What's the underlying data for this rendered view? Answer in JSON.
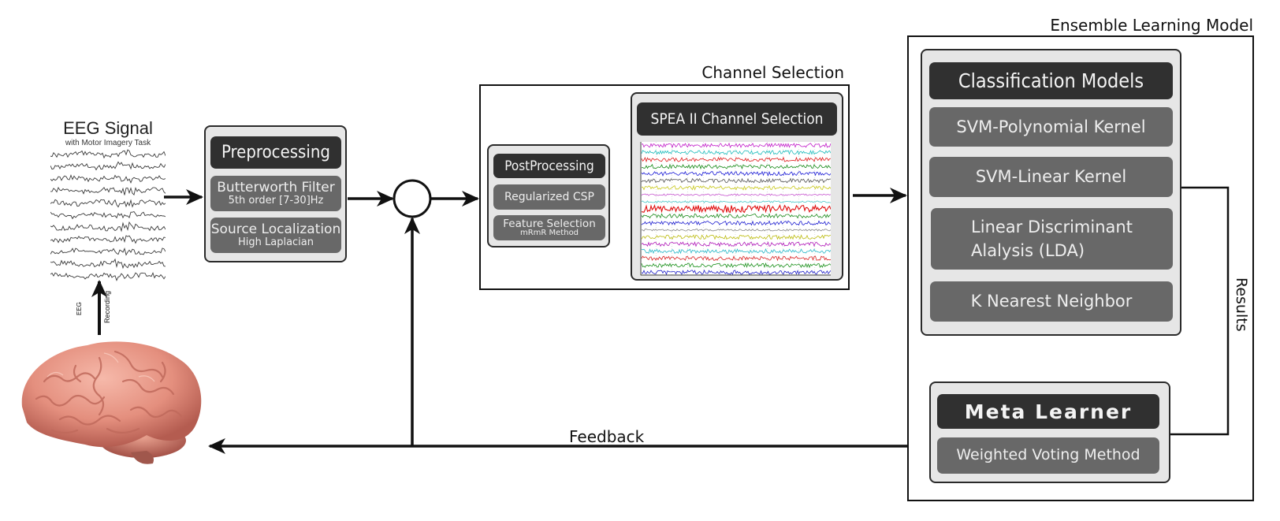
{
  "eeg_signal": {
    "title": "EEG Signal",
    "subtitle": "with Motor Imagery Task",
    "trace_count": 11
  },
  "recording": {
    "label_left": "EEG",
    "label_right": "Recording"
  },
  "brain": {
    "icon": "brain-icon"
  },
  "preprocessing": {
    "title": "Preprocessing",
    "items": [
      {
        "main": "Butterworth Filter",
        "sub": "5th order [7-30]Hz"
      },
      {
        "main": "Source Localization",
        "sub": "High Laplacian"
      }
    ]
  },
  "summing_junction": {
    "icon": "summing-junction-icon"
  },
  "channel_selection": {
    "frame_title": "Channel Selection",
    "postprocessing": {
      "title": "PostProcessing",
      "items": [
        {
          "main": "Regularized CSP",
          "sub": ""
        },
        {
          "main": "Feature Selection",
          "sub": "mRmR Method"
        }
      ]
    },
    "spea": {
      "title": "SPEA II Channel Selection",
      "trace_colors": [
        "#c21bc9",
        "#1fbcbc",
        "#e01818",
        "#168a16",
        "#1b1bd6",
        "#555555",
        "#c8c81a",
        "#c85ad0",
        "#4cc9c9",
        "#e01010",
        "#1a8a1a",
        "#1f1fd0",
        "#888888",
        "#bcbc10",
        "#b018b8",
        "#2ab8c8",
        "#d82020",
        "#1a901a",
        "#2020c8"
      ]
    }
  },
  "ensemble": {
    "frame_title": "Ensemble Learning Model",
    "classification": {
      "title": "Classification Models",
      "items": [
        "SVM-Polynomial Kernel",
        "SVM-Linear Kernel",
        "Linear Discriminant\nAlalysis (LDA)",
        "K Nearest Neighbor"
      ]
    },
    "meta_learner": {
      "title": "Meta Learner",
      "items": [
        "Weighted Voting Method"
      ]
    },
    "results_label": "Results"
  },
  "feedback": {
    "label": "Feedback"
  },
  "colors": {
    "panel_bg": "#e6e6e6",
    "header_bg": "#303030",
    "item_bg": "#686868",
    "line": "#111111"
  }
}
